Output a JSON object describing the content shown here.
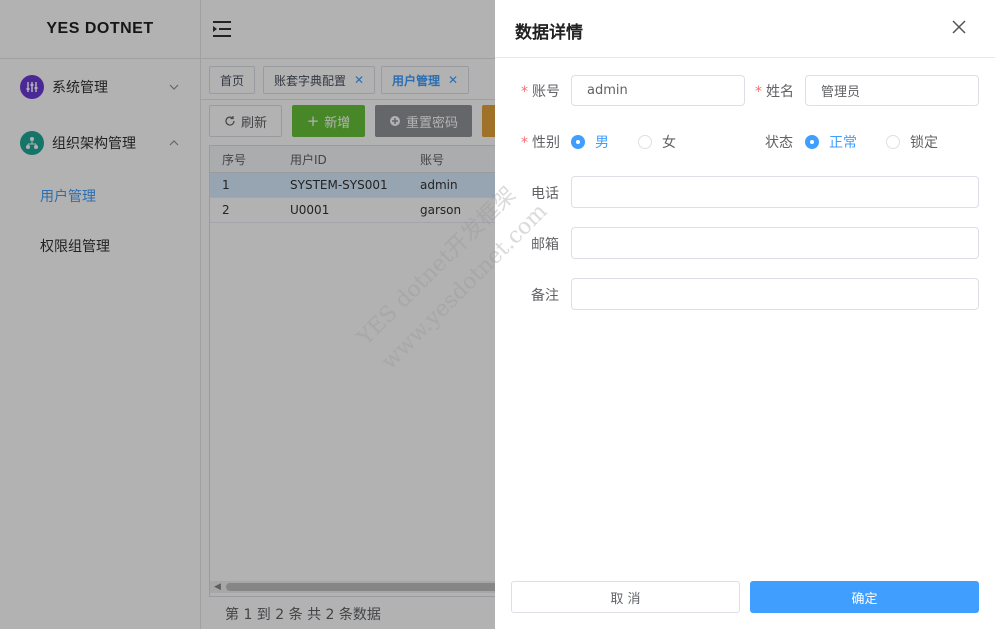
{
  "app": {
    "title": "YES DOTNET"
  },
  "sidebar": {
    "groups": [
      {
        "label": "系统管理",
        "icon": "system-settings-icon"
      },
      {
        "label": "组织架构管理",
        "icon": "org-structure-icon"
      }
    ],
    "subitems": [
      {
        "label": "用户管理",
        "active": true
      },
      {
        "label": "权限组管理",
        "active": false
      }
    ]
  },
  "tabs": [
    {
      "label": "首页"
    },
    {
      "label": "账套字典配置"
    },
    {
      "label": "用户管理"
    }
  ],
  "toolbar": {
    "refresh": "刷新",
    "add": "新增",
    "reset_password": "重置密码"
  },
  "table": {
    "headers": [
      "序号",
      "用户ID",
      "账号"
    ],
    "rows": [
      [
        "1",
        "SYSTEM-SYS001",
        "admin"
      ],
      [
        "2",
        "U0001",
        "garson"
      ]
    ]
  },
  "pager": {
    "summary": "第 1 到 2 条 共 2 条数据"
  },
  "drawer": {
    "title": "数据详情",
    "fields": {
      "account_label": "账号",
      "account_value": "admin",
      "name_label": "姓名",
      "name_value": "管理员",
      "gender_label": "性别",
      "gender_male": "男",
      "gender_female": "女",
      "status_label": "状态",
      "status_normal": "正常",
      "status_locked": "锁定",
      "phone_label": "电话",
      "email_label": "邮箱",
      "remark_label": "备注"
    },
    "cancel": "取 消",
    "confirm": "确定"
  },
  "watermark": {
    "line1": "YES dotnet开发框架",
    "line2": "www.yesdotnet.com"
  },
  "colors": {
    "primary": "#409eff",
    "success": "#67c23a",
    "info": "#909399",
    "warning": "#e6a23c",
    "danger": "#f56c6c"
  }
}
